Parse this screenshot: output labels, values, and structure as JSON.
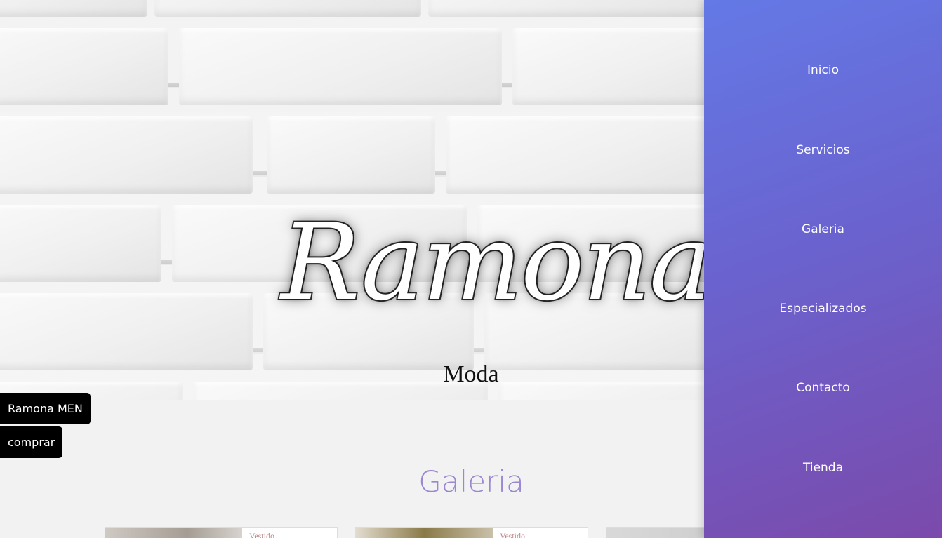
{
  "hero": {
    "title": "Ramona",
    "subtitle": "Moda"
  },
  "floating_buttons": {
    "men_label": "Ramona MEN",
    "shop_label": "comprar"
  },
  "gallery": {
    "title": "Galeria",
    "cards": [
      {
        "caption": "Vestido "
      },
      {
        "caption": "Vestido "
      },
      {
        "caption": ""
      }
    ]
  },
  "sidenav": {
    "items": [
      {
        "label": "Inicio"
      },
      {
        "label": "Servicios"
      },
      {
        "label": "Galeria"
      },
      {
        "label": "Especializados"
      },
      {
        "label": "Contacto"
      },
      {
        "label": "Tienda"
      }
    ]
  },
  "colors": {
    "nav_gradient_start": "#6479e6",
    "nav_gradient_end": "#7b4aab",
    "gallery_title": "#9b86d0",
    "button_bg": "#000000"
  }
}
